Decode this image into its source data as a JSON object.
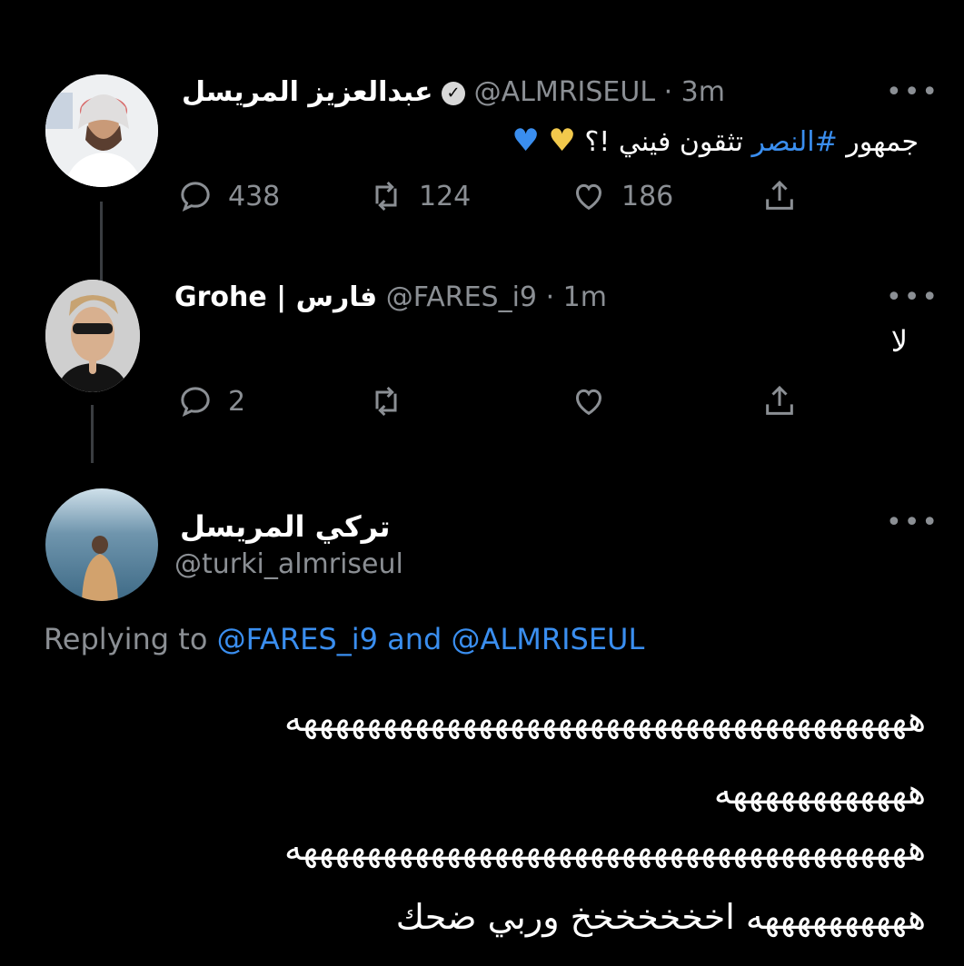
{
  "tweet1": {
    "display_name": "عبدالعزيز المريسل",
    "handle": "@ALMRISEUL",
    "time": "· 3m",
    "text_prefix": "جمهور",
    "hashtag": "#النصر",
    "text_suffix": "تثقون فيني !؟",
    "emojis": [
      "yellow-heart",
      "blue-heart"
    ],
    "replies": "438",
    "retweets": "124",
    "likes": "186"
  },
  "tweet2": {
    "display_name": "Grohe | فارس",
    "handle": "@FARES_i9",
    "time": "· 1m",
    "text": "لا",
    "replies": "2"
  },
  "tweet3": {
    "display_name": "تركي المريسل",
    "handle": "@turki_almriseul",
    "replying_prefix": "Replying to",
    "replying_user1": "@FARES_i9",
    "replying_and": "and",
    "replying_user2": "@ALMRISEUL",
    "lines": [
      "هههههههههههههههههههههههههههههههههههههههه",
      "ههههههههههههه",
      "هههههههههههههههههههههههههههههههههههههههه",
      "ههههههههههه اخخخخخخخ وربي ضحك"
    ]
  },
  "colors": {
    "background": "#000000",
    "link": "#3a8eef",
    "muted": "#8b8f94"
  }
}
